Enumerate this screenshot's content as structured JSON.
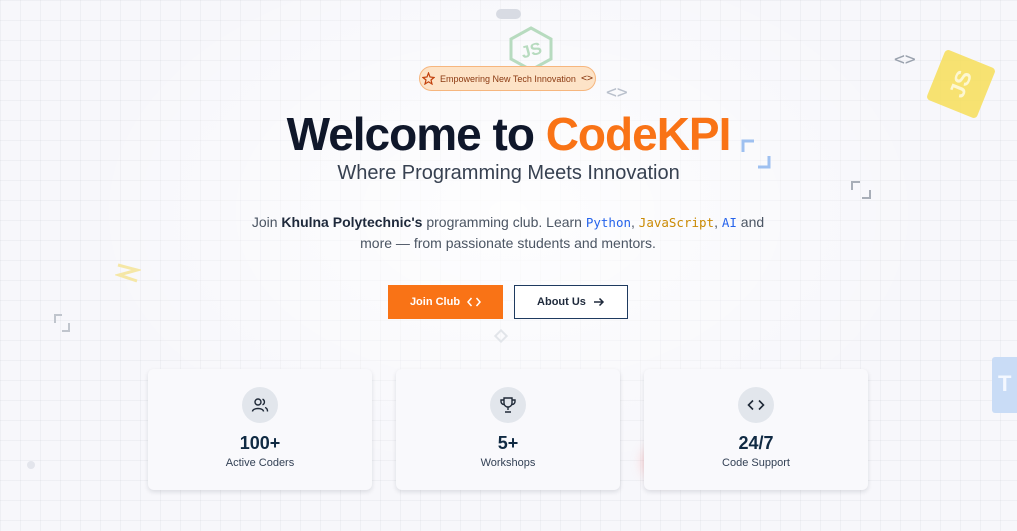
{
  "badge": {
    "text": "Empowering New Tech Innovation",
    "icon": "sparkle-star-icon",
    "trailing_icon": "code-brackets-icon"
  },
  "hero": {
    "title_prefix": "Welcome to",
    "title_brand": "CodeKPI",
    "subtitle": "Where Programming Meets Innovation",
    "desc_join": "Join",
    "desc_org": "Khulna Polytechnic's",
    "desc_mid": "programming club. Learn",
    "lang_python": "Python",
    "lang_js": "JavaScript",
    "lang_ai": "AI",
    "desc_and": "and",
    "desc_tail": "more — from passionate students and mentors."
  },
  "buttons": {
    "join": "Join Club",
    "about": "About Us"
  },
  "stats": [
    {
      "value": "100+",
      "label": "Active Coders",
      "icon": "users-icon"
    },
    {
      "value": "5+",
      "label": "Workshops",
      "icon": "trophy-icon"
    },
    {
      "value": "24/7",
      "label": "Code Support",
      "icon": "code-icon"
    }
  ],
  "decor": {
    "js_badge": "JS",
    "ts_badge": "T",
    "code_glyph": "<>"
  },
  "colors": {
    "brand": "#f97316",
    "heading": "#0f172a",
    "python": "#2563eb",
    "javascript": "#ca8a04",
    "badge_bg": "#fde3c7"
  }
}
